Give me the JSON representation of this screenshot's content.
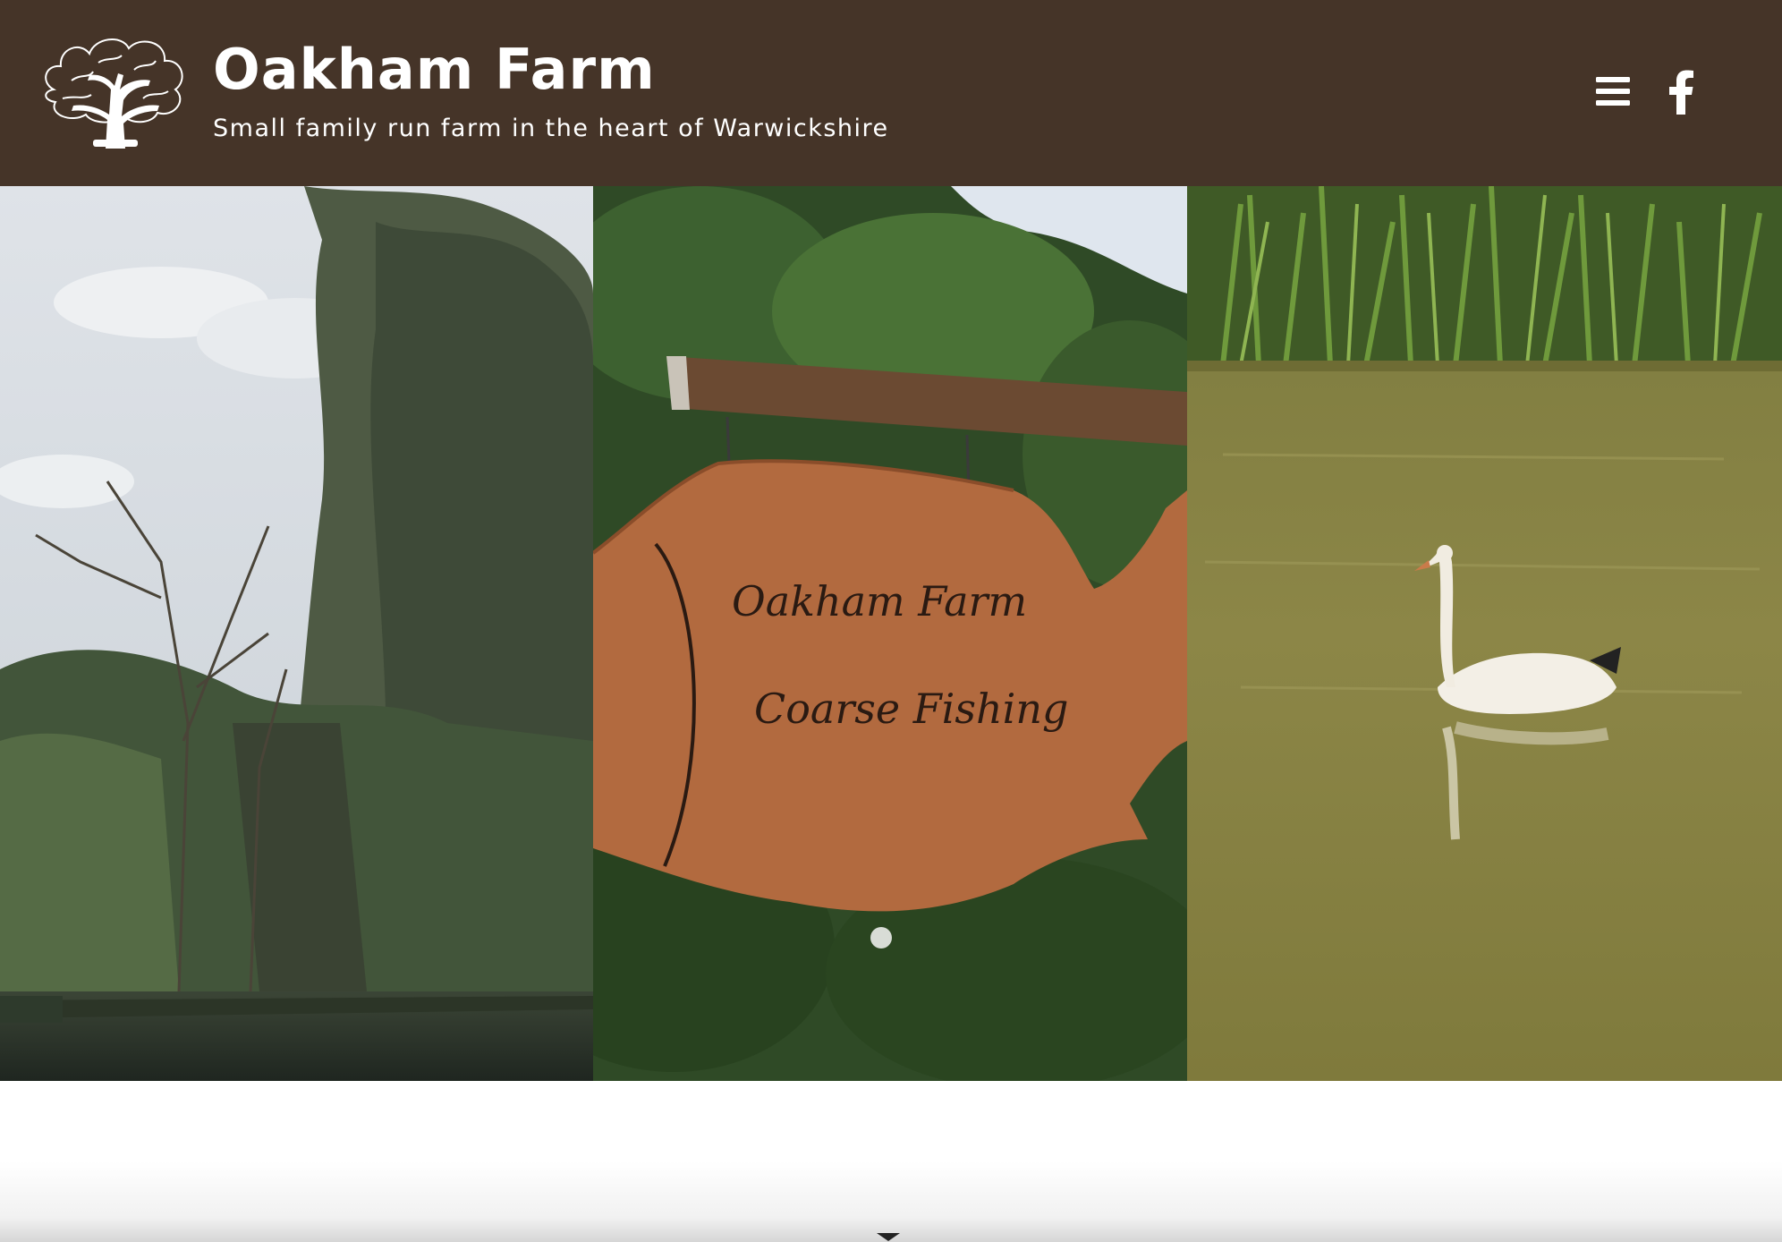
{
  "header": {
    "title": "Oakham Farm",
    "tagline": "Small family run farm in the heart of Warwickshire",
    "background_color": "#453428",
    "logo_icon": "oak-tree-icon",
    "menu_icon": "hamburger-menu-icon",
    "social_icon": "facebook-icon"
  },
  "gallery": {
    "photos": [
      {
        "subject": "trees-by-pond"
      },
      {
        "subject": "fish-shaped-wooden-sign",
        "sign_text": [
          "Oakham Farm",
          "Coarse Fishing"
        ]
      },
      {
        "subject": "swan-on-pond"
      }
    ]
  },
  "footer": {
    "scroll_icon": "chevron-down-icon"
  }
}
